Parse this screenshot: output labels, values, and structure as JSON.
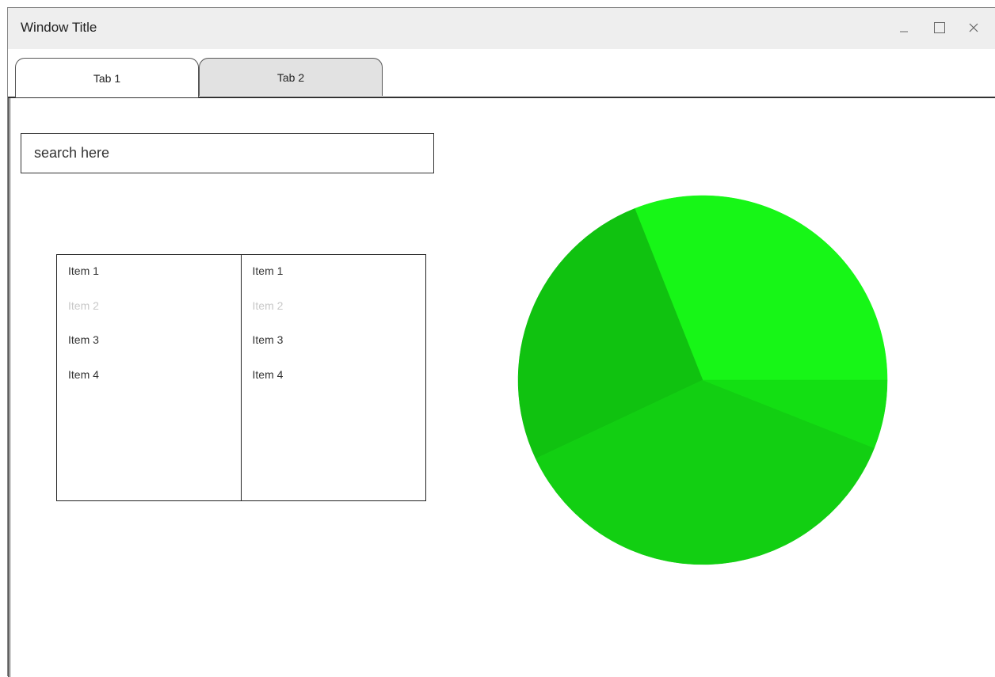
{
  "window": {
    "title": "Window Title"
  },
  "tabs": [
    {
      "label": "Tab 1",
      "active": true
    },
    {
      "label": "Tab 2",
      "active": false
    }
  ],
  "search": {
    "placeholder": "search here",
    "value": ""
  },
  "lists": {
    "left": [
      {
        "label": "Item 1",
        "disabled": false
      },
      {
        "label": "Item 2",
        "disabled": true
      },
      {
        "label": "Item 3",
        "disabled": false
      },
      {
        "label": "Item 4",
        "disabled": false
      }
    ],
    "right": [
      {
        "label": "Item 1",
        "disabled": false
      },
      {
        "label": "Item 2",
        "disabled": true
      },
      {
        "label": "Item 3",
        "disabled": false
      },
      {
        "label": "Item 4",
        "disabled": false
      }
    ]
  },
  "chart_data": {
    "type": "pie",
    "slices": [
      {
        "value": 31,
        "color": "#17f617"
      },
      {
        "value": 26,
        "color": "#10c210"
      },
      {
        "value": 37,
        "color": "#12cf12"
      },
      {
        "value": 6,
        "color": "#13df13"
      }
    ]
  },
  "icons": {
    "minimize": "minimize-icon",
    "maximize": "maximize-icon",
    "close": "close-icon"
  },
  "colors": {
    "titlebar": "#eeeeee",
    "inactive_tab": "#e2e2e2",
    "disabled_text": "#c8c8c8"
  }
}
